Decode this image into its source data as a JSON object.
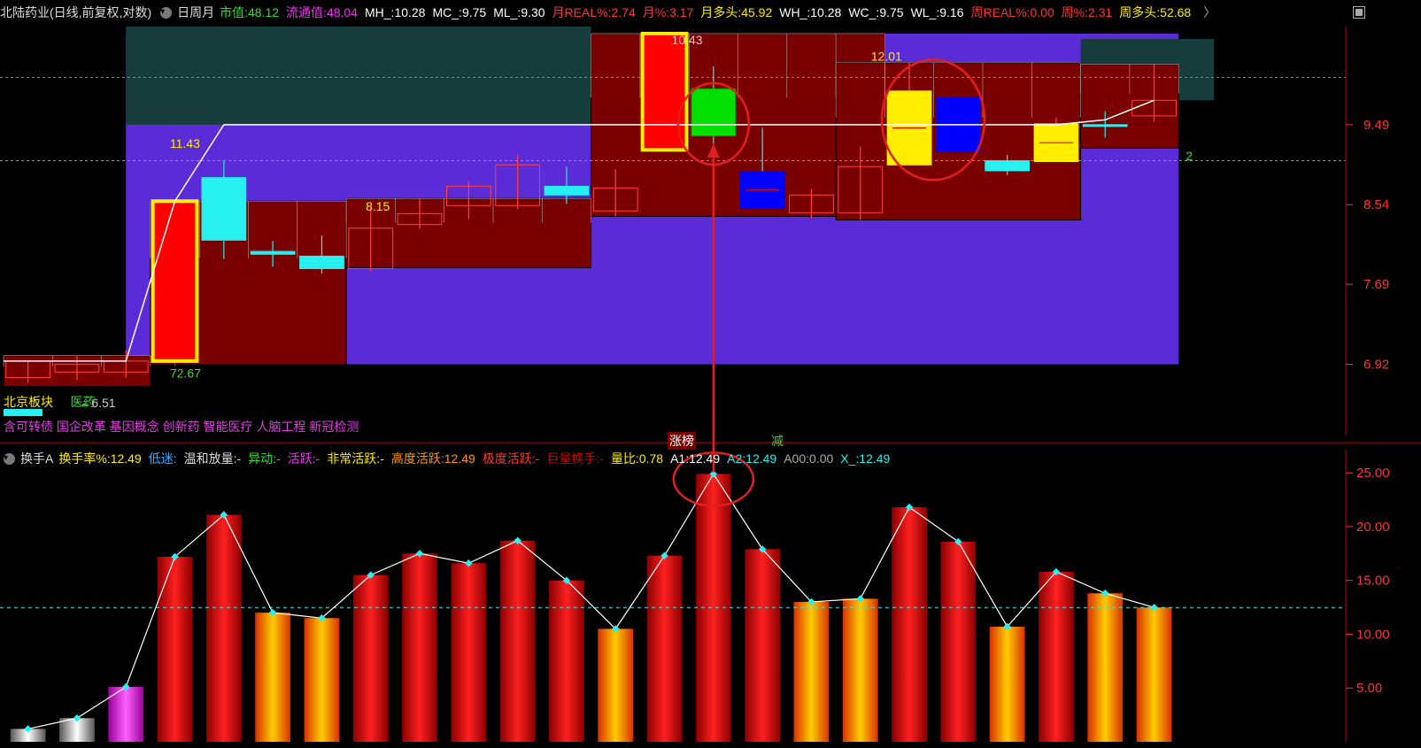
{
  "colors": {
    "bg": "#000000",
    "band": "#5b2bd8",
    "band_dark": "#163c3c",
    "box_fill": "#7a0000",
    "box_border": "#cfcfcf",
    "up_red": "#ff0000",
    "cyan": "#26f0f0",
    "green": "#00e000",
    "blue": "#0000ff",
    "yellow": "#ffee00",
    "magenta": "#e040e0",
    "circle_red": "#e02020",
    "white": "#ffffff"
  },
  "header": {
    "stock": "北陆药业(日线,前复权,对数)",
    "period_toggle": "日周月",
    "fields": [
      {
        "label": "市值:",
        "value": "48.12",
        "color": "#33dd33"
      },
      {
        "label": "流通值:",
        "value": "48.04",
        "color": "#ee33ee"
      },
      {
        "label": "MH_:",
        "value": "10.28",
        "color": "#ffffff"
      },
      {
        "label": "MC_:",
        "value": "9.75",
        "color": "#ffffff"
      },
      {
        "label": "ML_:",
        "value": "9.30",
        "color": "#ffffff"
      },
      {
        "label": "月REAL%:",
        "value": "2.74",
        "color": "#ff3333"
      },
      {
        "label": "月%:",
        "value": "3.17",
        "color": "#ff3333"
      },
      {
        "label": "月多头:",
        "value": "45.92",
        "color": "#ffee00"
      },
      {
        "label": "WH_:",
        "value": "10.28",
        "color": "#ffffff"
      },
      {
        "label": "WC_:",
        "value": "9.75",
        "color": "#ffffff"
      },
      {
        "label": "WL_:",
        "value": "9.16",
        "color": "#ffffff"
      },
      {
        "label": "周REAL%:",
        "value": "0.00",
        "color": "#ff3333"
      },
      {
        "label": "周%:",
        "value": "2.31",
        "color": "#ff3333"
      },
      {
        "label": "周多头:",
        "value": "52.68",
        "color": "#ffee00"
      }
    ],
    "more_icon": "chevron-right-icon"
  },
  "sector": {
    "board": "北京板块",
    "industry": "医药"
  },
  "concepts": "含可转债  国企改革  基因概念  创新药  智能医疗  人脑工程  新冠检测",
  "tags": {
    "limit_list": "涨榜",
    "reduce": "减"
  },
  "annotations": {
    "high_top": "10.43",
    "high_right": "12.01",
    "box_high_mid": "8.15",
    "box_high_left": "11.43",
    "low_left": "6.51",
    "low_mid": "72.67",
    "right_edge": "2"
  },
  "sub_header": {
    "indicator": "换手A",
    "fields": [
      {
        "label": "换手率%:",
        "value": "12.49",
        "color": "#ffee00"
      },
      {
        "label": "低迷:",
        "value": "",
        "color": "#33aaff"
      },
      {
        "label": "温和放量:",
        "value": "-",
        "color": "#dddddd"
      },
      {
        "label": "异动:",
        "value": "-",
        "color": "#33dd33"
      },
      {
        "label": "活跃:",
        "value": "-",
        "color": "#ee33ee"
      },
      {
        "label": "非常活跃:",
        "value": "-",
        "color": "#ffee00"
      },
      {
        "label": "高度活跃:",
        "value": "12.49",
        "color": "#ff9900"
      },
      {
        "label": "极度活跃:",
        "value": "-",
        "color": "#ff3333"
      },
      {
        "label": "巨量换手:",
        "value": "-",
        "color": "#cc0000"
      },
      {
        "label": "量比:",
        "value": "0.78",
        "color": "#ffee00"
      },
      {
        "label": "A1:",
        "value": "12.49",
        "color": "#ffffff"
      },
      {
        "label": "A2:",
        "value": "12.49",
        "color": "#26f0f0"
      },
      {
        "label": "A00:",
        "value": "0.00",
        "color": "#aaaaaa"
      },
      {
        "label": "X_:",
        "value": "12.49",
        "color": "#26f0f0"
      }
    ]
  },
  "chart_data": [
    {
      "type": "candlestick",
      "scale": "log",
      "y_ticks": [
        9.49,
        8.54,
        7.69,
        6.92
      ],
      "ylim": [
        6.3,
        10.8
      ],
      "horizontal_lines": [
        10.1,
        9.05
      ],
      "candles": [
        {
          "o": 6.8,
          "h": 6.95,
          "l": 6.75,
          "c": 6.95,
          "color": "red_box"
        },
        {
          "o": 6.92,
          "h": 7.0,
          "l": 6.78,
          "c": 6.85,
          "color": "red_box"
        },
        {
          "o": 6.85,
          "h": 7.05,
          "l": 6.8,
          "c": 6.95,
          "color": "red_box"
        },
        {
          "o": 6.95,
          "h": 8.58,
          "l": 6.9,
          "c": 8.58,
          "color": "limit_up"
        },
        {
          "o": 8.15,
          "h": 9.05,
          "l": 7.95,
          "c": 8.85,
          "color": "cyan"
        },
        {
          "o": 8.03,
          "h": 8.14,
          "l": 7.87,
          "c": 8.0,
          "color": "cyan"
        },
        {
          "o": 7.98,
          "h": 8.2,
          "l": 7.8,
          "c": 7.85,
          "color": "cyan"
        },
        {
          "o": 7.85,
          "h": 8.51,
          "l": 7.82,
          "c": 8.28,
          "color": "red_box"
        },
        {
          "o": 8.32,
          "h": 8.61,
          "l": 8.27,
          "c": 8.44,
          "color": "red_box"
        },
        {
          "o": 8.53,
          "h": 8.81,
          "l": 8.38,
          "c": 8.75,
          "color": "red_box"
        },
        {
          "o": 8.53,
          "h": 9.12,
          "l": 8.49,
          "c": 9.0,
          "color": "red_box"
        },
        {
          "o": 8.65,
          "h": 8.98,
          "l": 8.55,
          "c": 8.75,
          "color": "cyan"
        },
        {
          "o": 8.47,
          "h": 8.95,
          "l": 8.41,
          "c": 8.73,
          "color": "red_box"
        },
        {
          "o": 9.18,
          "h": 10.7,
          "l": 9.18,
          "c": 10.7,
          "color": "limit_up"
        },
        {
          "o": 9.95,
          "h": 10.25,
          "l": 9.25,
          "c": 9.35,
          "color": "green"
        },
        {
          "o": 8.92,
          "h": 9.45,
          "l": 8.92,
          "c": 8.5,
          "color": "blue"
        },
        {
          "o": 8.45,
          "h": 8.72,
          "l": 8.39,
          "c": 8.65,
          "color": "red_box"
        },
        {
          "o": 8.45,
          "h": 9.22,
          "l": 8.37,
          "c": 8.98,
          "color": "red_box"
        },
        {
          "o": 9.0,
          "h": 10.3,
          "l": 9.0,
          "c": 9.92,
          "color": "yellow"
        },
        {
          "o": 9.16,
          "h": 9.75,
          "l": 9.16,
          "c": 9.83,
          "color": "blue"
        },
        {
          "o": 9.05,
          "h": 9.12,
          "l": 8.88,
          "c": 8.93,
          "color": "cyan"
        },
        {
          "o": 9.04,
          "h": 9.58,
          "l": 9.04,
          "c": 9.5,
          "color": "yellow"
        },
        {
          "o": 9.49,
          "h": 9.66,
          "l": 9.33,
          "c": 9.49,
          "color": "cyan"
        },
        {
          "o": 9.6,
          "h": 10.28,
          "l": 9.53,
          "c": 9.8,
          "color": "red_box"
        }
      ],
      "ma_line": [
        6.95,
        6.95,
        6.95,
        8.58,
        9.49,
        9.49,
        9.49,
        9.49,
        9.49,
        9.49,
        9.49,
        9.49,
        9.49,
        9.49,
        9.49,
        9.49,
        9.49,
        9.49,
        9.49,
        9.49,
        9.49,
        9.49,
        9.55,
        9.8
      ],
      "ranges": [
        {
          "from": 0,
          "to": 2,
          "hi": 7.0,
          "lo": 6.72,
          "type": "box"
        },
        {
          "from": 3,
          "to": 6,
          "hi": 8.58,
          "lo": 6.92,
          "type": "box"
        },
        {
          "from": 7,
          "to": 11,
          "hi": 8.61,
          "lo": 7.86,
          "type": "box"
        },
        {
          "from": 12,
          "to": 17,
          "hi": 10.7,
          "lo": 8.41,
          "type": "box"
        },
        {
          "from": 17,
          "to": 21,
          "hi": 10.3,
          "lo": 8.37,
          "type": "box"
        },
        {
          "from": 22,
          "to": 23,
          "hi": 10.28,
          "lo": 9.2,
          "type": "box"
        }
      ],
      "bands": [
        {
          "from": 2,
          "to": 5,
          "hi": 10.7,
          "lo": 6.92,
          "color": "band"
        },
        {
          "from": 5,
          "to": 23,
          "hi": 10.7,
          "lo": 6.92,
          "color": "band"
        }
      ]
    },
    {
      "type": "bar",
      "title": "换手A",
      "y_ticks": [
        25.0,
        20.0,
        15.0,
        10.0,
        5.0
      ],
      "ylim": [
        0,
        26
      ],
      "horizontal_lines": [
        12.49
      ],
      "values": [
        1.2,
        2.2,
        5.1,
        17.2,
        21.1,
        12.0,
        11.5,
        15.5,
        17.5,
        16.6,
        18.7,
        15.0,
        10.5,
        17.3,
        24.9,
        17.9,
        13.0,
        13.3,
        21.8,
        18.6,
        10.7,
        15.8,
        13.8,
        12.49
      ],
      "styles": [
        "gray",
        "gray",
        "magenta",
        "red",
        "red",
        "orange",
        "orange",
        "red",
        "red",
        "red",
        "red",
        "red",
        "orange",
        "red",
        "red",
        "red",
        "orange",
        "orange",
        "red",
        "red",
        "orange",
        "red",
        "orange",
        "orange"
      ],
      "line": [
        1.2,
        2.2,
        5.1,
        17.2,
        21.1,
        12.0,
        11.5,
        15.5,
        17.5,
        16.6,
        18.7,
        15.0,
        10.5,
        17.3,
        24.9,
        17.9,
        13.0,
        13.3,
        21.8,
        18.6,
        10.7,
        15.8,
        13.8,
        12.49
      ]
    }
  ]
}
